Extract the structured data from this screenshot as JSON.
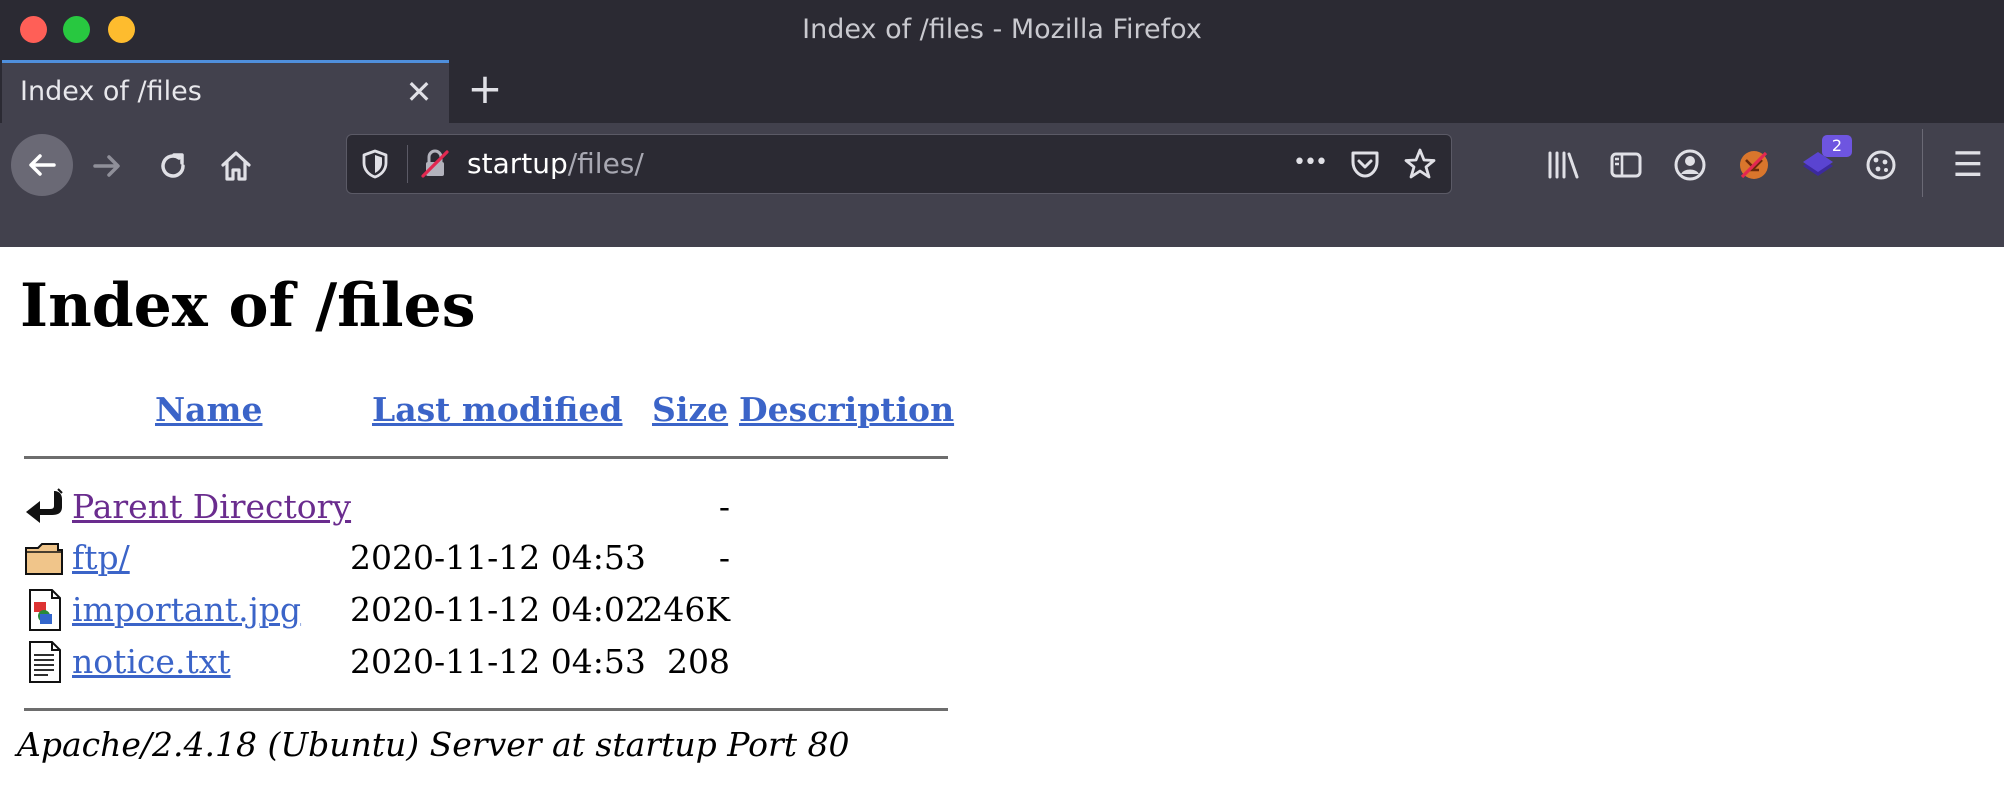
{
  "window": {
    "title": "Index of /files - Mozilla Firefox",
    "controls": {
      "close_color": "#ff5f57",
      "minimize_color": "#28c840",
      "maximize_color": "#febc2e"
    }
  },
  "tab": {
    "label": "Index of /files",
    "close_glyph": "✕"
  },
  "new_tab_glyph": "+",
  "toolbar": {
    "icons": [
      "back-icon",
      "forward-icon",
      "reload-icon",
      "home-icon",
      "library-icon",
      "sidebar-icon",
      "account-icon",
      "extension-icon",
      "extension-badge-icon",
      "cookie-icon",
      "menu-icon"
    ],
    "extension_badge_count": "2",
    "menu_glyph": "☰"
  },
  "urlbar": {
    "host": "startup",
    "path": "/files/",
    "more_glyph": "•••"
  },
  "page": {
    "heading": "Index of /files",
    "columns": {
      "name": "Name",
      "last_modified": "Last modified",
      "size": "Size",
      "description": "Description"
    },
    "rows": [
      {
        "icon": "back-arrow-icon",
        "name": "Parent Directory",
        "date": "",
        "size": "-"
      },
      {
        "icon": "folder-icon",
        "name": "ftp/",
        "date": "2020-11-12 04:53",
        "size": "-"
      },
      {
        "icon": "image-file-icon",
        "name": "important.jpg",
        "date": "2020-11-12 04:02",
        "size": "246K"
      },
      {
        "icon": "text-file-icon",
        "name": "notice.txt",
        "date": "2020-11-12 04:53",
        "size": "208"
      }
    ],
    "footer": "Apache/2.4.18 (Ubuntu) Server at startup Port 80"
  },
  "colors": {
    "chrome_dark": "#2b2a33",
    "chrome_mid": "#42414d",
    "tab_accent": "#4f8fdc",
    "link": "#3b64c8",
    "visited_link": "#6a2c8e"
  }
}
